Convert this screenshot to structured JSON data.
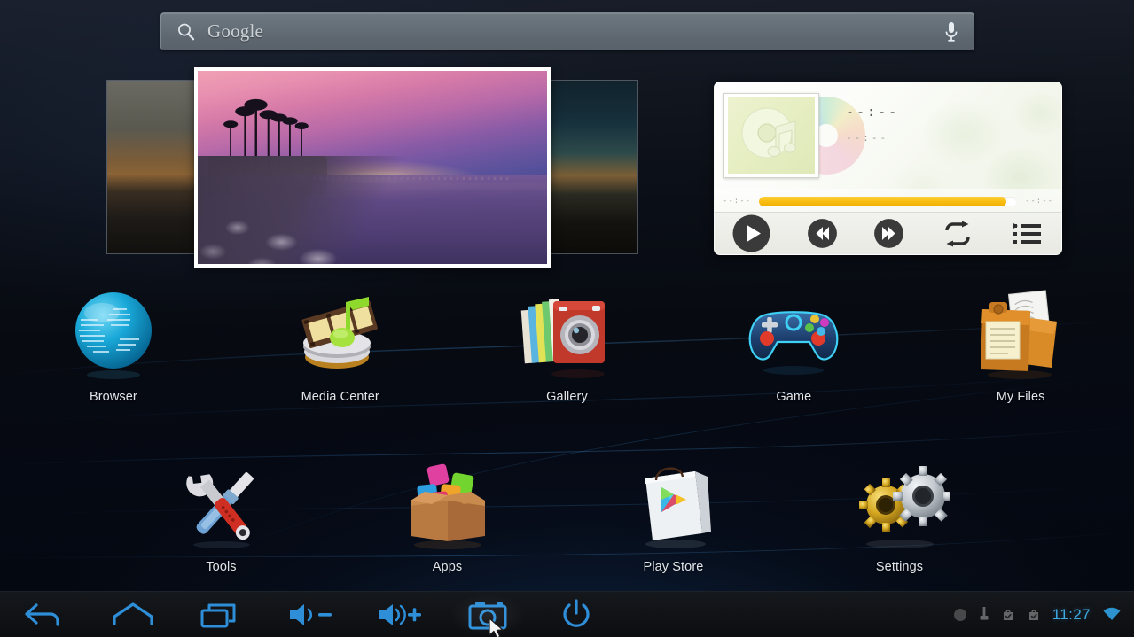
{
  "search": {
    "logo_text": "Google",
    "placeholder": "Google",
    "search_icon": "search-icon",
    "mic_icon": "microphone-icon"
  },
  "gallery_widget": {
    "name": "photo-gallery-widget",
    "photos": [
      {
        "caption": ""
      },
      {
        "caption": ""
      },
      {
        "caption": ""
      }
    ]
  },
  "music_widget": {
    "track_title": "--:--",
    "track_artist": "--:--",
    "elapsed_time": "--:--",
    "total_time": "--:--",
    "progress_percent": 96,
    "accent_color": "#f9bd12",
    "controls": [
      {
        "name": "play-button",
        "icon": "play-icon"
      },
      {
        "name": "previous-button",
        "icon": "previous-icon"
      },
      {
        "name": "next-button",
        "icon": "next-icon"
      },
      {
        "name": "repeat-button",
        "icon": "repeat-icon"
      },
      {
        "name": "playlist-button",
        "icon": "playlist-icon"
      }
    ]
  },
  "apps": {
    "row1": [
      {
        "label": "Browser",
        "icon": "browser-globe-icon"
      },
      {
        "label": "Media Center",
        "icon": "media-center-icon"
      },
      {
        "label": "Gallery",
        "icon": "gallery-camera-icon"
      },
      {
        "label": "Game",
        "icon": "game-controller-icon"
      },
      {
        "label": "My Files",
        "icon": "my-files-folder-icon"
      }
    ],
    "row2": [
      {
        "label": "Tools",
        "icon": "tools-wrench-icon"
      },
      {
        "label": "Apps",
        "icon": "apps-box-icon"
      },
      {
        "label": "Play Store",
        "icon": "play-store-bag-icon"
      },
      {
        "label": "Settings",
        "icon": "settings-gears-icon"
      }
    ]
  },
  "navbar": {
    "buttons": [
      {
        "name": "back-button",
        "icon": "back-arrow-icon"
      },
      {
        "name": "home-button",
        "icon": "home-icon"
      },
      {
        "name": "recents-button",
        "icon": "recent-apps-icon"
      },
      {
        "name": "volume-down-button",
        "icon": "volume-down-icon"
      },
      {
        "name": "volume-up-button",
        "icon": "volume-up-icon"
      },
      {
        "name": "screenshot-button",
        "icon": "camera-icon"
      },
      {
        "name": "power-button",
        "icon": "power-icon"
      }
    ]
  },
  "status_bar": {
    "clock": "11:27",
    "clock_color": "#3ea8e0",
    "icons": [
      {
        "name": "circle-status-icon"
      },
      {
        "name": "usb-status-icon"
      },
      {
        "name": "sd-check-icon-1"
      },
      {
        "name": "sd-check-icon-2"
      },
      {
        "name": "wifi-icon"
      }
    ]
  }
}
